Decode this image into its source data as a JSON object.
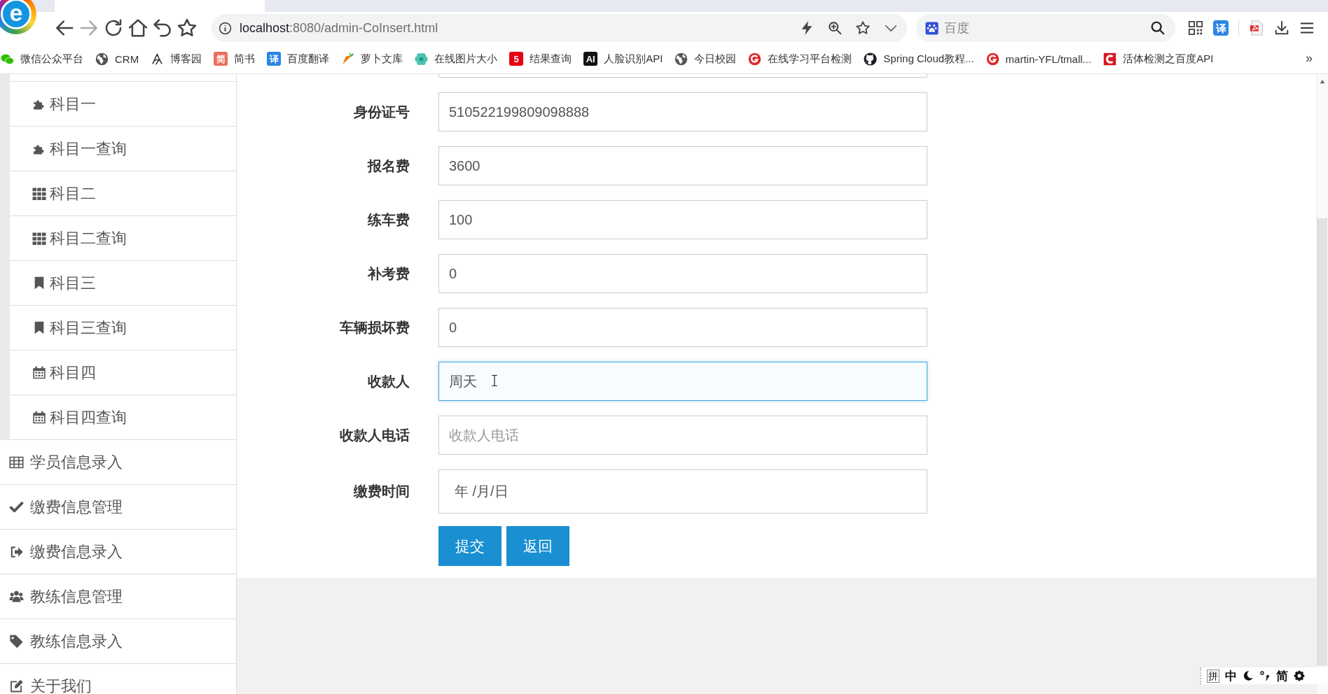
{
  "browser": {
    "logo_glyph": "e",
    "url": {
      "host": "localhost",
      "path": ":8080/admin-CoInsert.html"
    },
    "search": {
      "placeholder": "百度"
    },
    "translate_glyph": "译"
  },
  "bookmarks": {
    "items": [
      {
        "label": "微信公众平台"
      },
      {
        "label": "CRM"
      },
      {
        "label": "博客园"
      },
      {
        "label": "简书",
        "glyph": "简"
      },
      {
        "label": "百度翻译",
        "glyph": "译"
      },
      {
        "label": "萝卜文库"
      },
      {
        "label": "在线图片大小"
      },
      {
        "label": "结果查询",
        "glyph": "5"
      },
      {
        "label": "人脸识别API",
        "glyph": "AI"
      },
      {
        "label": "今日校园"
      },
      {
        "label": "在线学习平台检测"
      },
      {
        "label": "Spring Cloud教程..."
      },
      {
        "label": "martin-YFL/tmall..."
      },
      {
        "label": "活体检测之百度API"
      }
    ],
    "more": "»"
  },
  "sidebar": {
    "open_group": {
      "children": [
        "科目一",
        "科目一查询",
        "科目二",
        "科目二查询",
        "科目三",
        "科目三查询",
        "科目四",
        "科目四查询"
      ]
    },
    "items": [
      "学员信息录入",
      "缴费信息管理",
      "缴费信息录入",
      "教练信息管理",
      "教练信息录入",
      "关于我们"
    ]
  },
  "form": {
    "fields": [
      {
        "kind": "text",
        "label": "身份证号",
        "value": "510522199809098888",
        "focused": false
      },
      {
        "kind": "text",
        "label": "报名费",
        "value": "3600",
        "focused": false
      },
      {
        "kind": "text",
        "label": "练车费",
        "value": "100",
        "focused": false
      },
      {
        "kind": "text",
        "label": "补考费",
        "value": "0",
        "focused": false
      },
      {
        "kind": "text",
        "label": "车辆损坏费",
        "value": "0",
        "focused": false
      },
      {
        "kind": "text",
        "label": "收款人",
        "value": "周天",
        "focused": true
      },
      {
        "kind": "text",
        "label": "收款人电话",
        "placeholder": "收款人电话",
        "focused": false
      },
      {
        "kind": "date",
        "label": "缴费时间",
        "value": "年 /月/日",
        "focused": false
      }
    ],
    "buttons": [
      "提交",
      "返回"
    ]
  },
  "ime_bar": {
    "mode": "拼",
    "language": "中",
    "script": "简"
  }
}
